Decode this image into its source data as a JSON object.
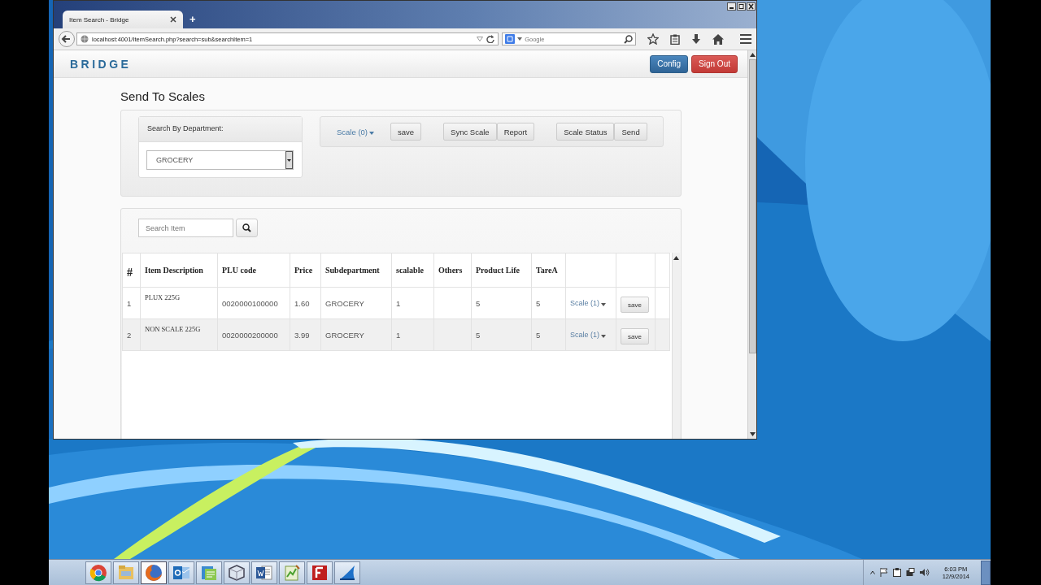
{
  "browser": {
    "tab_title": "Item Search - Bridge",
    "new_tab": "+",
    "url": "localhost:4001/ItemSearch.php?search=sub&searchItem=1",
    "search_placeholder": "Google"
  },
  "app": {
    "brand": "BRIDGE",
    "nav_buttons": [
      {
        "label": "Config",
        "kind": "primary"
      },
      {
        "label": "Sign Out",
        "kind": "danger"
      }
    ]
  },
  "page_title": "Send To Scales",
  "department": {
    "label": "Search By Department:",
    "value": "GROCERY"
  },
  "toolbar_groups": [
    [
      {
        "label": "Scale (0)",
        "kind": "dropdown"
      }
    ],
    [
      {
        "label": "save",
        "kind": "button"
      }
    ],
    [
      {
        "label": "Sync Scale",
        "kind": "button"
      },
      {
        "label": "Report",
        "kind": "button"
      }
    ],
    [
      {
        "label": "Scale Status",
        "kind": "button"
      },
      {
        "label": "Send",
        "kind": "button"
      }
    ]
  ],
  "search": {
    "placeholder": "Search Item"
  },
  "table": {
    "columns": [
      "#",
      "Item Description",
      "PLU code",
      "Price",
      "Subdepartment",
      "scalable",
      "Others",
      "Product Life",
      "TareA"
    ],
    "rows": [
      {
        "cells": [
          "1",
          "PLUX 225G",
          "0020000100000",
          "1.60",
          "GROCERY",
          "1",
          "",
          "5",
          "5"
        ],
        "scale": "Scale (1)",
        "action": "save"
      },
      {
        "cells": [
          "2",
          "NON SCALE 225G",
          "0020000200000",
          "3.99",
          "GROCERY",
          "1",
          "",
          "5",
          "5"
        ],
        "scale": "Scale (1)",
        "action": "save"
      }
    ]
  },
  "taskbar": {
    "apps": [
      {
        "kind": "chrome",
        "active": false
      },
      {
        "kind": "folder",
        "active": false
      },
      {
        "kind": "firefox",
        "active": true
      },
      {
        "kind": "outlook",
        "active": false
      },
      {
        "kind": "docs",
        "active": false
      },
      {
        "kind": "cube",
        "active": false
      },
      {
        "kind": "word",
        "active": false
      },
      {
        "kind": "notepad",
        "active": false
      },
      {
        "kind": "filezilla",
        "active": false
      },
      {
        "kind": "shark",
        "active": false
      }
    ],
    "clock": {
      "time": "6:03 PM",
      "date": "12/9/2014"
    }
  }
}
